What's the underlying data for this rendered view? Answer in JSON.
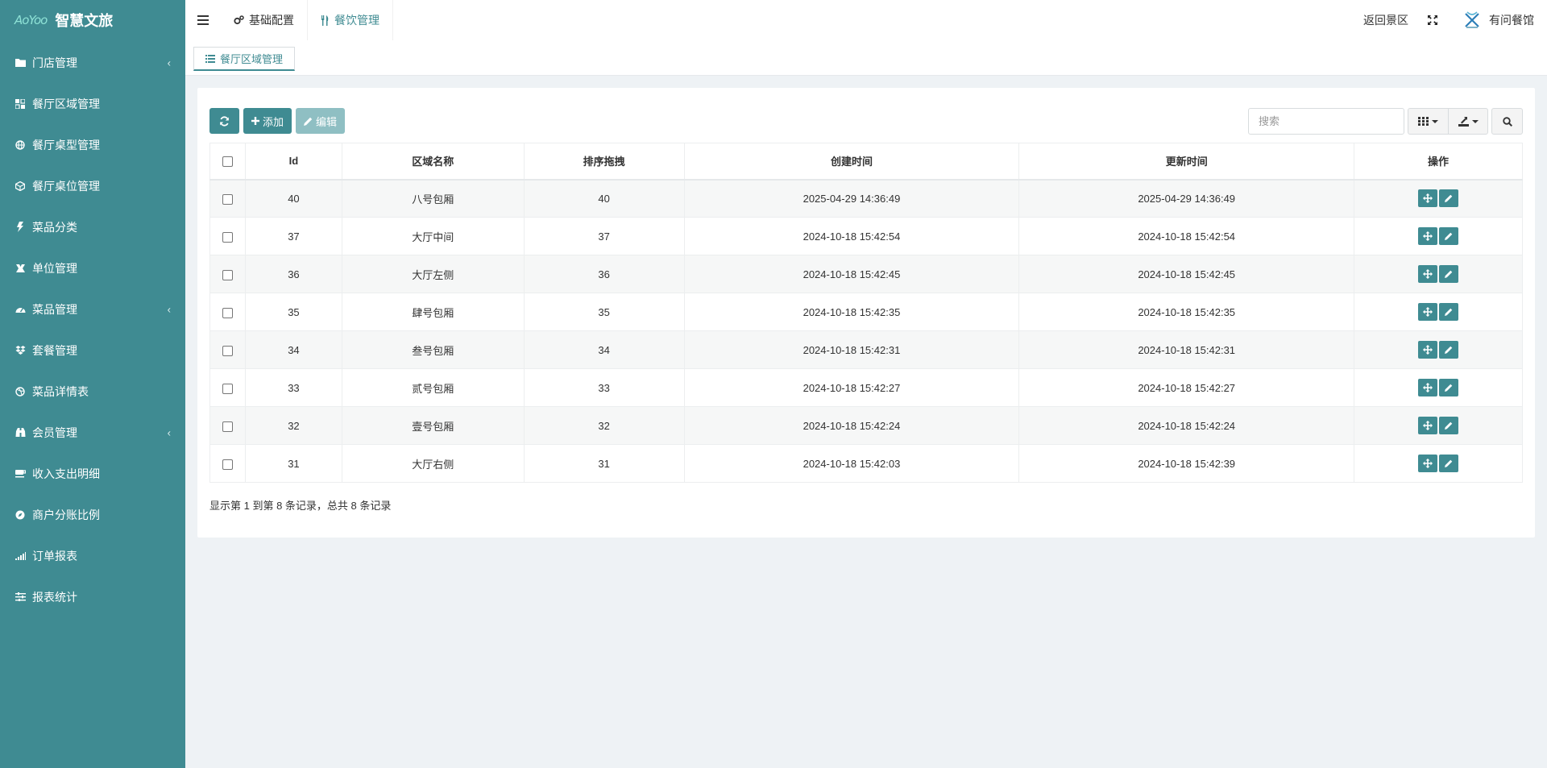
{
  "brand": {
    "logo_text": "AoYoo",
    "title": "智慧文旅"
  },
  "sidebar": {
    "items": [
      {
        "label": "门店管理",
        "icon": "folder-icon",
        "has_arrow": true
      },
      {
        "label": "餐厅区域管理",
        "icon": "grid-icon",
        "has_arrow": false
      },
      {
        "label": "餐厅桌型管理",
        "icon": "globe-icon",
        "has_arrow": false
      },
      {
        "label": "餐厅桌位管理",
        "icon": "cube-icon",
        "has_arrow": false
      },
      {
        "label": "菜品分类",
        "icon": "bolt-icon",
        "has_arrow": false
      },
      {
        "label": "单位管理",
        "icon": "scale-icon",
        "has_arrow": false
      },
      {
        "label": "菜品管理",
        "icon": "dashboard-icon",
        "has_arrow": true
      },
      {
        "label": "套餐管理",
        "icon": "dropbox-icon",
        "has_arrow": false
      },
      {
        "label": "菜品详情表",
        "icon": "dribbble-icon",
        "has_arrow": false
      },
      {
        "label": "会员管理",
        "icon": "binoculars-icon",
        "has_arrow": true
      },
      {
        "label": "收入支出明细",
        "icon": "coffee-icon",
        "has_arrow": false
      },
      {
        "label": "商户分账比例",
        "icon": "compass-icon",
        "has_arrow": false
      },
      {
        "label": "订单报表",
        "icon": "signal-icon",
        "has_arrow": false
      },
      {
        "label": "报表统计",
        "icon": "sliders-icon",
        "has_arrow": false
      }
    ],
    "arrow_glyph": "‹"
  },
  "topbar": {
    "tabs": [
      {
        "label": "基础配置",
        "icon": "cogs-icon",
        "active": false
      },
      {
        "label": "餐饮管理",
        "icon": "cutlery-icon",
        "active": true
      }
    ],
    "back_link": "返回景区",
    "user_name": "有问餐馆"
  },
  "subtab": {
    "label": "餐厅区域管理",
    "icon": "list-icon"
  },
  "toolbar": {
    "add_label": "添加",
    "edit_label": "编辑",
    "search_placeholder": "搜索"
  },
  "table": {
    "columns": [
      "Id",
      "区域名称",
      "排序拖拽",
      "创建时间",
      "更新时间",
      "操作"
    ],
    "rows": [
      {
        "id": "40",
        "name": "八号包厢",
        "sort": "40",
        "created": "2025-04-29 14:36:49",
        "updated": "2025-04-29 14:36:49"
      },
      {
        "id": "37",
        "name": "大厅中间",
        "sort": "37",
        "created": "2024-10-18 15:42:54",
        "updated": "2024-10-18 15:42:54"
      },
      {
        "id": "36",
        "name": "大厅左侧",
        "sort": "36",
        "created": "2024-10-18 15:42:45",
        "updated": "2024-10-18 15:42:45"
      },
      {
        "id": "35",
        "name": "肆号包厢",
        "sort": "35",
        "created": "2024-10-18 15:42:35",
        "updated": "2024-10-18 15:42:35"
      },
      {
        "id": "34",
        "name": "叁号包厢",
        "sort": "34",
        "created": "2024-10-18 15:42:31",
        "updated": "2024-10-18 15:42:31"
      },
      {
        "id": "33",
        "name": "贰号包厢",
        "sort": "33",
        "created": "2024-10-18 15:42:27",
        "updated": "2024-10-18 15:42:27"
      },
      {
        "id": "32",
        "name": "壹号包厢",
        "sort": "32",
        "created": "2024-10-18 15:42:24",
        "updated": "2024-10-18 15:42:24"
      },
      {
        "id": "31",
        "name": "大厅右侧",
        "sort": "31",
        "created": "2024-10-18 15:42:03",
        "updated": "2024-10-18 15:42:39"
      }
    ]
  },
  "pagination": {
    "summary": "显示第 1 到第 8 条记录，总共 8 条记录"
  },
  "colors": {
    "accent": "#3f8b92",
    "sidebar_bg": "#3f8b92",
    "disabled_button": "#8fbfc3",
    "page_bg": "#eef2f5"
  }
}
